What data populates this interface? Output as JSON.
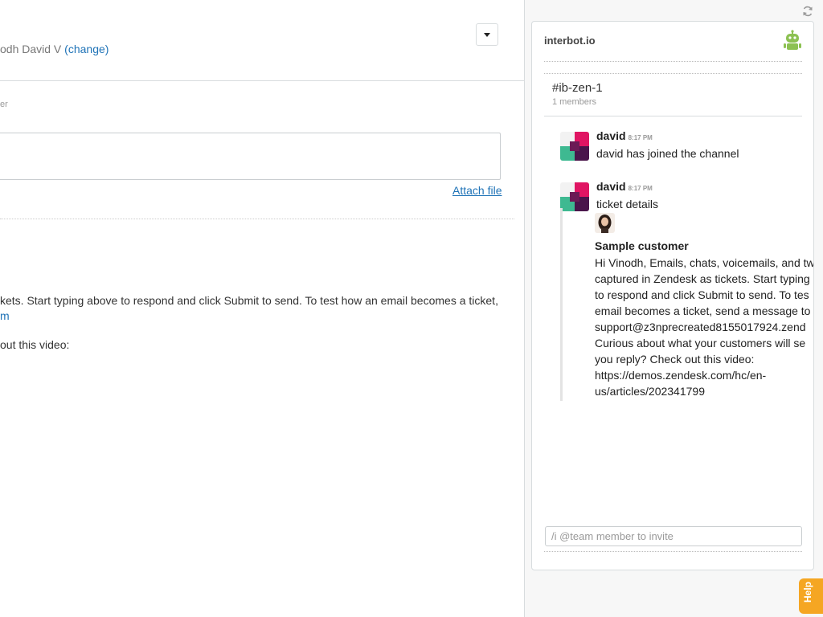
{
  "ticket": {
    "requester_partial": "odh David V",
    "change_link": "(change)",
    "field_label_partial": "er",
    "attach_file": "Attach file",
    "body_lines": [
      {
        "text": "kets. Start typing above to respond and click Submit to send. To test how an email becomes a ticket,",
        "link": false
      },
      {
        "text": "m",
        "link": true
      },
      {
        "text": "out this video:",
        "link": false
      }
    ]
  },
  "sidebar": {
    "app_name": "interbot.io",
    "channel": {
      "name": "#ib-zen-1",
      "members": "1 members"
    },
    "messages": [
      {
        "author": "david",
        "time": "8:17 PM",
        "text": "david has joined the channel"
      },
      {
        "author": "david",
        "time": "8:17 PM",
        "text": "ticket details"
      }
    ],
    "attachment": {
      "title": "Sample customer",
      "lines": [
        "Hi Vinodh, Emails, chats, voicemails, and tw",
        "captured in Zendesk as tickets. Start typing",
        "to respond and click Submit to send. To tes",
        "email becomes a ticket, send a message to",
        "support@z3nprecreated8155017924.zend",
        "Curious about what your customers will se",
        "you reply? Check out this video:",
        "https://demos.zendesk.com/hc/en-",
        "us/articles/202341799"
      ]
    },
    "invite_placeholder": "/i @team member to invite",
    "help_label": "Help"
  },
  "icons": {
    "refresh": "refresh-icon",
    "robot": "robot-icon",
    "menu_caret": "caret-down-icon"
  },
  "colors": {
    "link": "#1f73b7",
    "robot_green": "#8cc152",
    "help_orange": "#f5a623",
    "avatar_pink": "#e01563",
    "avatar_green": "#3eb991",
    "avatar_purple": "#4a154b"
  }
}
